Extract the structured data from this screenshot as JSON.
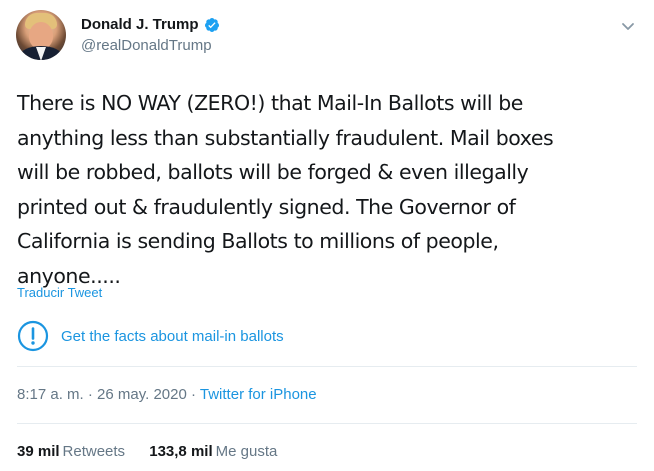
{
  "author": {
    "display_name": "Donald J. Trump",
    "handle": "@realDonaldTrump",
    "verified_icon": "verified-badge-icon",
    "avatar": "profile-photo"
  },
  "menu": {
    "icon": "chevron-down-icon"
  },
  "tweet": {
    "text": "There is NO WAY (ZERO!) that Mail-In Ballots will be\nanything less than substantially fraudulent. Mail boxes\nwill be robbed, ballots will be forged & even illegally\nprinted out & fraudulently signed. The Governor of\nCalifornia is sending Ballots to millions of people,\nanyone.....",
    "translate_label": "Traducir Tweet"
  },
  "notice": {
    "icon": "exclamation-icon",
    "text": "Get the facts about mail-in ballots"
  },
  "meta": {
    "time": "8:17 a. m.",
    "separator": " · ",
    "date": "26 may. 2020",
    "source": "Twitter for iPhone"
  },
  "stats": {
    "retweets_count": "39 mil",
    "retweets_label": "Retweets",
    "likes_count": "133,8 mil",
    "likes_label": "Me gusta"
  },
  "colors": {
    "link": "#1b95e0",
    "text": "#14171a",
    "muted": "#657786",
    "divider": "#e6ecf0"
  }
}
